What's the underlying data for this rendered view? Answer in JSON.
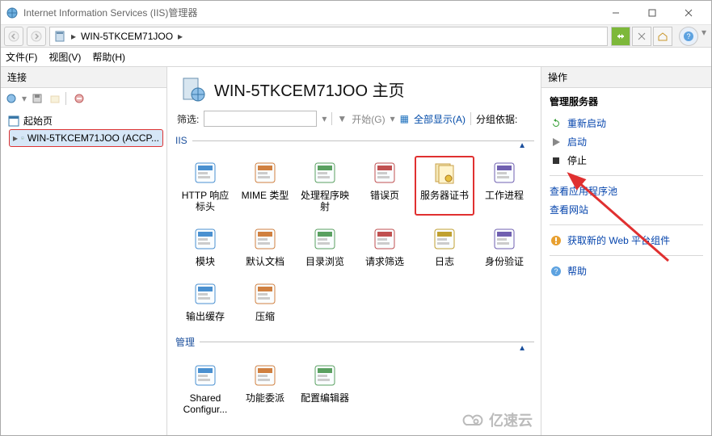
{
  "window": {
    "title": "Internet Information Services (IIS)管理器"
  },
  "breadcrumb": {
    "node": "WIN-5TKCEM71JOO"
  },
  "menu": {
    "file": "文件(F)",
    "view": "视图(V)",
    "help": "帮助(H)"
  },
  "left": {
    "title": "连接",
    "start_page": "起始页",
    "server_node": "WIN-5TKCEM71JOO (ACCP..."
  },
  "center": {
    "heading": "WIN-5TKCEM71JOO 主页",
    "filter_label": "筛选:",
    "go_label": "开始(G)",
    "show_all": "全部显示(A)",
    "group_by": "分组依据:",
    "section_iis": "IIS",
    "section_mgmt": "管理",
    "iis_features": [
      "HTTP 响应标头",
      "MIME 类型",
      "处理程序映射",
      "错误页",
      "服务器证书",
      "工作进程",
      "模块",
      "默认文档",
      "目录浏览",
      "请求筛选",
      "日志",
      "身份验证",
      "输出缓存",
      "压缩"
    ],
    "highlight_index": 4,
    "mgmt_features": [
      "Shared Configur...",
      "功能委派",
      "配置编辑器"
    ]
  },
  "actions": {
    "title": "操作",
    "heading": "管理服务器",
    "restart": "重新启动",
    "start": "启动",
    "stop": "停止",
    "view_app_pools": "查看应用程序池",
    "view_sites": "查看网站",
    "get_webpi": "获取新的 Web 平台组件",
    "help": "帮助"
  },
  "watermark": "亿速云"
}
